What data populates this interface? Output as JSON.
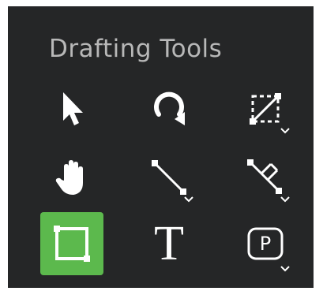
{
  "panel": {
    "title": "Drafting Tools"
  },
  "tools": [
    {
      "name": "select",
      "icon": "arrow-pointer-icon",
      "selected": false,
      "has_submenu": false
    },
    {
      "name": "rotate",
      "icon": "rotate-icon",
      "selected": false,
      "has_submenu": false
    },
    {
      "name": "resize",
      "icon": "resize-box-icon",
      "selected": false,
      "has_submenu": true
    },
    {
      "name": "pan",
      "icon": "hand-icon",
      "selected": false,
      "has_submenu": false
    },
    {
      "name": "line",
      "icon": "line-icon",
      "selected": false,
      "has_submenu": true
    },
    {
      "name": "dimension",
      "icon": "dimension-line-icon",
      "selected": false,
      "has_submenu": true
    },
    {
      "name": "rectangle",
      "icon": "rectangle-icon",
      "selected": true,
      "has_submenu": false
    },
    {
      "name": "text",
      "icon": "text-icon",
      "label": "T",
      "selected": false,
      "has_submenu": false
    },
    {
      "name": "point",
      "icon": "point-badge-icon",
      "label": "P",
      "selected": false,
      "has_submenu": true
    }
  ],
  "colors": {
    "panel_bg": "#252627",
    "selected_bg": "#5cb94d",
    "title": "#b8b8b8",
    "icon": "#ffffff"
  }
}
